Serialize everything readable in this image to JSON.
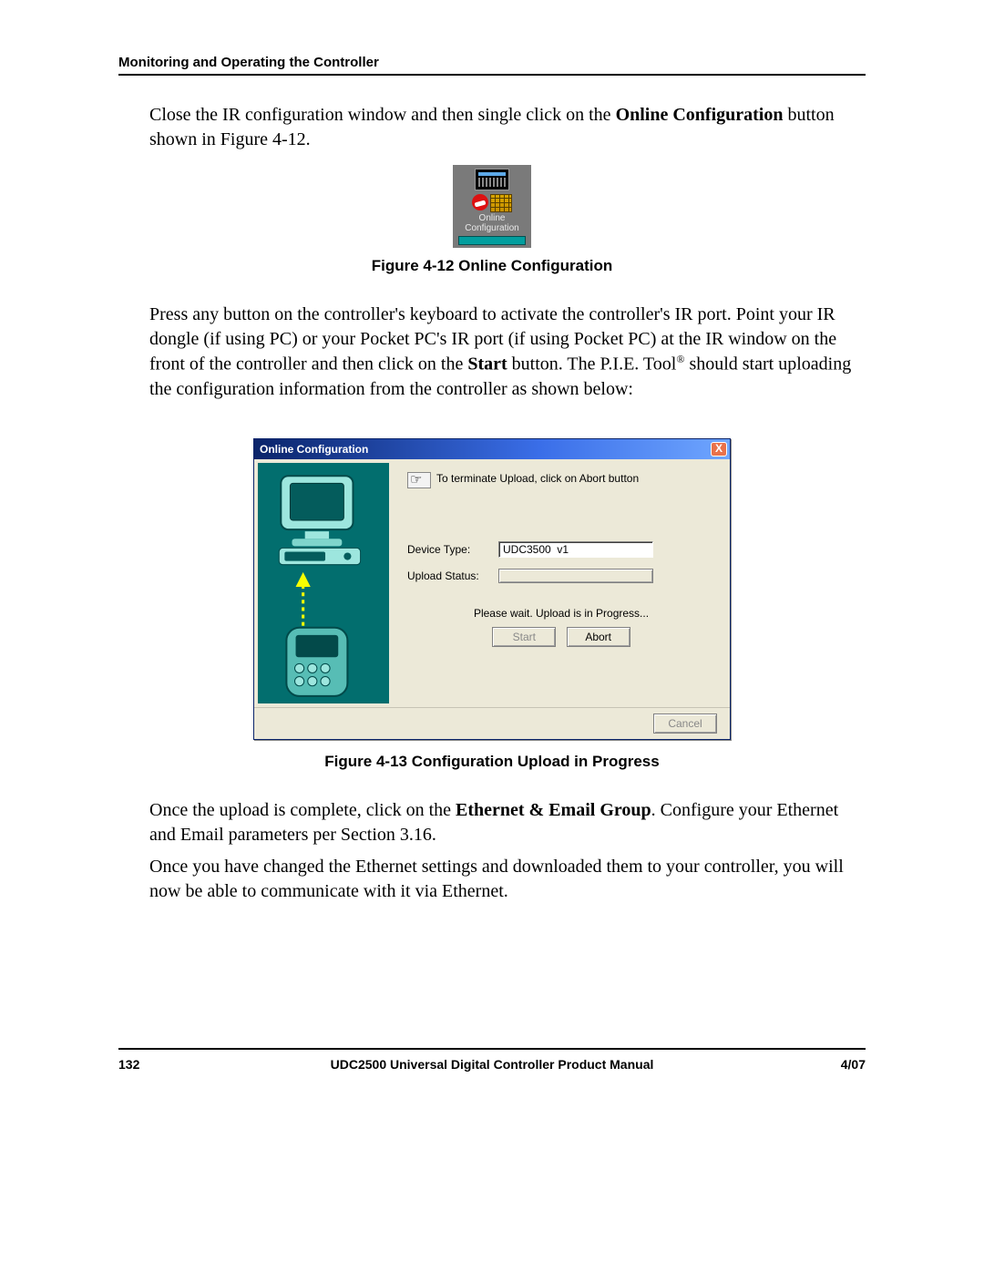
{
  "header": {
    "section_title": "Monitoring and Operating the Controller"
  },
  "para1": {
    "pre": "Close the IR configuration window and then single click on the ",
    "bold": "Online Configuration",
    "post": " button shown in Figure 4-12."
  },
  "figure412": {
    "icon_label_line1": "Online",
    "icon_label_line2": "Configuration",
    "caption": "Figure 4-12  Online Configuration"
  },
  "para2": {
    "t1": "Press any button on the controller's keyboard to activate the controller's IR port. Point your IR dongle (if using PC) or your Pocket PC's IR port (if using Pocket PC) at the IR window on the front of the controller and then click on the ",
    "bold": "Start",
    "t2": " button. The P.I.E. Tool",
    "reg": "®",
    "t3": " should start uploading the configuration information from the controller as shown below:"
  },
  "dialog": {
    "title": "Online Configuration",
    "close_glyph": "X",
    "hint": "To terminate Upload, click on Abort button",
    "device_type_label": "Device Type:",
    "device_type_value": "UDC3500  v1",
    "upload_status_label": "Upload Status:",
    "wait_msg": "Please wait. Upload is in Progress...",
    "start_btn": "Start",
    "abort_btn": "Abort",
    "cancel_btn": "Cancel"
  },
  "figure413": {
    "caption": "Figure 4-13  Configuration Upload in Progress"
  },
  "para3": {
    "pre": "Once the upload is complete, click on the ",
    "bold": "Ethernet & Email Group",
    "post": ". Configure your Ethernet and Email parameters per Section 3.16."
  },
  "para4": "Once you have changed the Ethernet settings and downloaded them to your controller, you will now be able to communicate with it via Ethernet.",
  "footer": {
    "page": "132",
    "manual": "UDC2500 Universal Digital Controller Product Manual",
    "date": "4/07"
  }
}
